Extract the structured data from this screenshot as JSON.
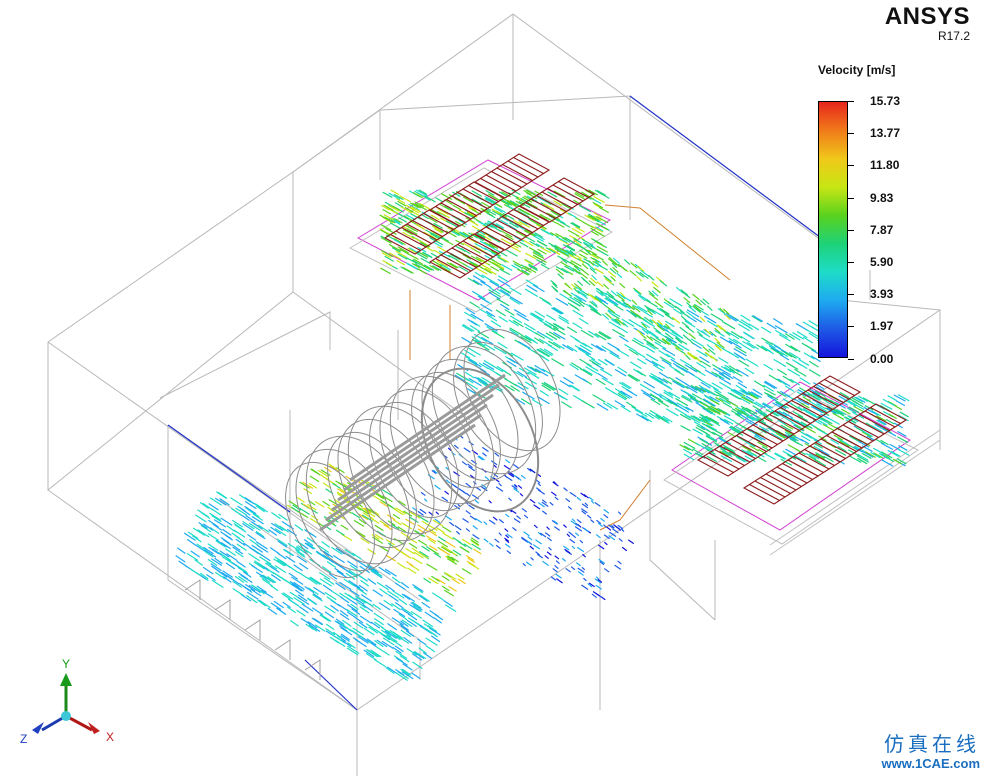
{
  "brand": {
    "name": "ANSYS",
    "version": "R17.2"
  },
  "legend": {
    "title": "Velocity [m/s]",
    "ticks": [
      "15.73",
      "13.77",
      "11.80",
      "9.83",
      "7.87",
      "5.90",
      "3.93",
      "1.97",
      "0.00"
    ],
    "gradient": [
      "#e8261c",
      "#f07a1a",
      "#f0c81a",
      "#c8e614",
      "#5ad21e",
      "#1ed278",
      "#1edcc8",
      "#1eaaf0",
      "#1e5ae6",
      "#1414dc"
    ]
  },
  "triad": {
    "y_label": "Y",
    "x_label": "X",
    "z_label": "Z"
  },
  "watermark": {
    "line1": "仿真在线",
    "line2": "www.1CAE.com"
  },
  "colors": {
    "wireframe": "#b8b8b8",
    "edge_blue": "#2233cc",
    "edge_magenta": "#d040d0",
    "edge_orange": "#d08030",
    "grille": "#8b1a1a",
    "fan": "#8c8c8c"
  }
}
